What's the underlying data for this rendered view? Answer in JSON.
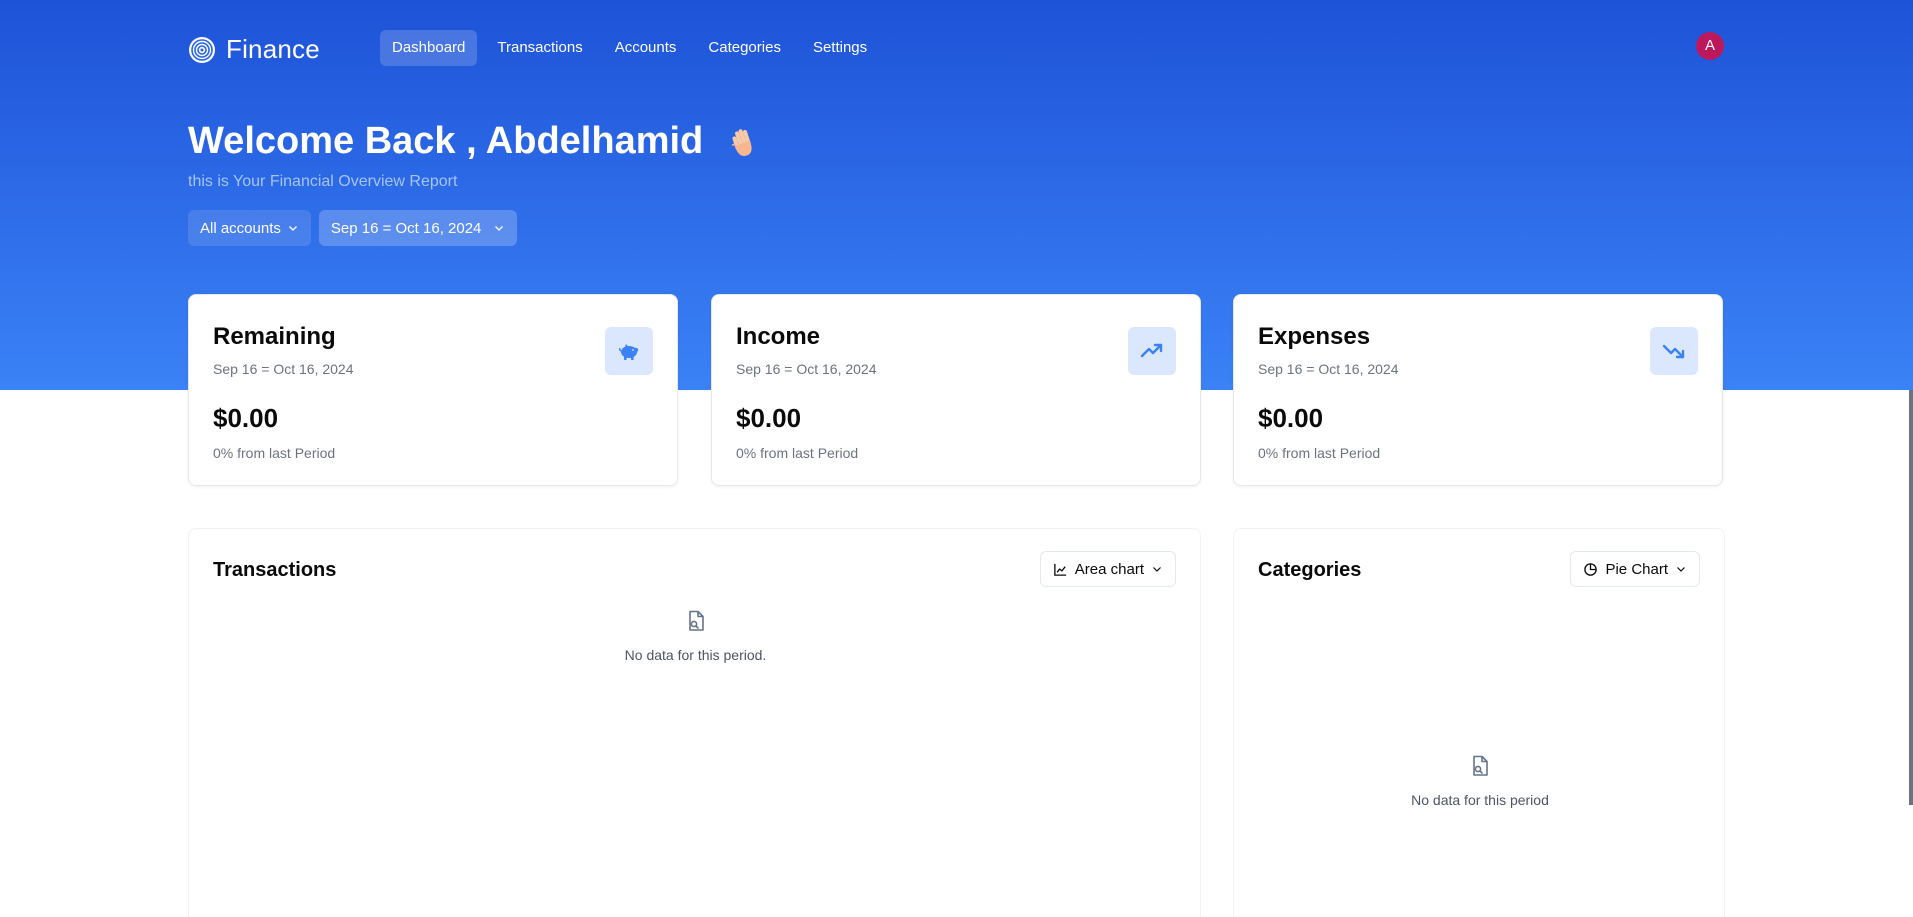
{
  "app": {
    "name": "Finance"
  },
  "nav": {
    "items": [
      {
        "label": "Dashboard",
        "active": true
      },
      {
        "label": "Transactions",
        "active": false
      },
      {
        "label": "Accounts",
        "active": false
      },
      {
        "label": "Categories",
        "active": false
      },
      {
        "label": "Settings",
        "active": false
      }
    ]
  },
  "user": {
    "initial": "A",
    "avatar_color": "#be185d"
  },
  "welcome": {
    "title": "Welcome Back , Abdelhamid",
    "subtitle": "this is Your Financial Overview Report",
    "icon": "waving-hand-icon"
  },
  "filters": {
    "account": "All accounts",
    "date_range": "Sep 16 = Oct 16, 2024"
  },
  "cards": [
    {
      "title": "Remaining",
      "range": "Sep 16 = Oct 16, 2024",
      "amount": "$0.00",
      "change": "0% from last Period",
      "icon": "piggy-bank-icon"
    },
    {
      "title": "Income",
      "range": "Sep 16 = Oct 16, 2024",
      "amount": "$0.00",
      "change": "0% from last Period",
      "icon": "trending-up-icon"
    },
    {
      "title": "Expenses",
      "range": "Sep 16 = Oct 16, 2024",
      "amount": "$0.00",
      "change": "0% from last Period",
      "icon": "trending-down-icon"
    }
  ],
  "transactions_panel": {
    "title": "Transactions",
    "chart_type": "Area chart",
    "empty_message": "No data for this period."
  },
  "categories_panel": {
    "title": "Categories",
    "chart_type": "Pie Chart",
    "empty_message": "No data for this period"
  },
  "colors": {
    "hero_top": "#1e53d8",
    "hero_bottom": "#3b82f6",
    "accent": "#3b82f6",
    "icon_bg": "#dbe7fd"
  }
}
